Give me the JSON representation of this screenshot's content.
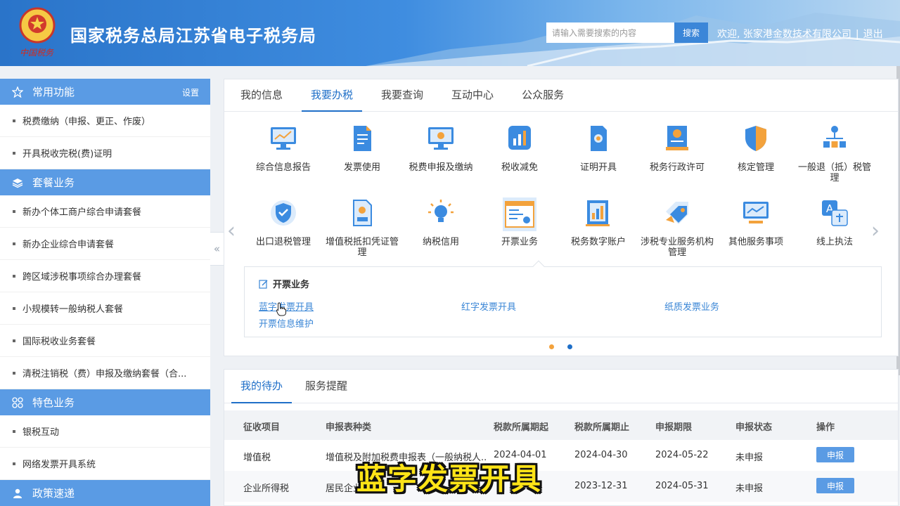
{
  "header": {
    "title": "国家税务总局江苏省电子税务局",
    "brand_script": "中国税务",
    "search_placeholder": "请输入需要搜索的内容",
    "search_button": "搜索",
    "welcome": "欢迎, 张家港金数技术有限公司",
    "separator": "|",
    "logout": "退出"
  },
  "sidebar": {
    "sections": [
      {
        "title": "常用功能",
        "setting": "设置",
        "icon": "star-icon",
        "items": [
          "税费缴纳（申报、更正、作废）",
          "开具税收完税(费)证明"
        ]
      },
      {
        "title": "套餐业务",
        "icon": "layers-icon",
        "items": [
          "新办个体工商户综合申请套餐",
          "新办企业综合申请套餐",
          "跨区域涉税事项综合办理套餐",
          "小规模转一般纳税人套餐",
          "国际税收业务套餐",
          "清税注销税（费）申报及缴纳套餐（合..."
        ]
      },
      {
        "title": "特色业务",
        "icon": "grid-icon",
        "items": [
          "银税互动",
          "网络发票开具系统"
        ]
      },
      {
        "title": "政策速递",
        "icon": "user-icon",
        "items": []
      }
    ]
  },
  "main": {
    "tabs": [
      "我的信息",
      "我要办税",
      "我要查询",
      "互动中心",
      "公众服务"
    ],
    "active_tab": "我要办税",
    "services_row1": [
      "综合信息报告",
      "发票使用",
      "税费申报及缴纳",
      "税收减免",
      "证明开具",
      "税务行政许可",
      "核定管理",
      "一般退（抵）税管理"
    ],
    "services_row2": [
      "出口退税管理",
      "增值税抵扣凭证管理",
      "纳税信用",
      "开票业务",
      "税务数字账户",
      "涉税专业服务机构管理",
      "其他服务事项",
      "线上执法"
    ],
    "submenu": {
      "title": "开票业务",
      "links": [
        "蓝字发票开具",
        "红字发票开具",
        "纸质发票业务",
        "开票信息维护"
      ]
    }
  },
  "todo": {
    "tabs": [
      "我的待办",
      "服务提醒"
    ],
    "columns": [
      "征收项目",
      "申报表种类",
      "税款所属期起",
      "税款所属期止",
      "申报期限",
      "申报状态",
      "操作"
    ],
    "rows": [
      [
        "增值税",
        "增值税及附加税费申报表（一般纳税人...",
        "2024-04-01",
        "2024-04-30",
        "2024-05-22",
        "未申报",
        "申报"
      ],
      [
        "企业所得税",
        "居民企业",
        "",
        "2023-12-31",
        "2024-05-31",
        "未申报",
        "申报"
      ]
    ]
  },
  "caption": "蓝字发票开具",
  "colors": {
    "accent": "#1f6fc8",
    "sidebar_head": "#5a9be4",
    "link": "#3a86d6",
    "caption": "#ffe417"
  }
}
